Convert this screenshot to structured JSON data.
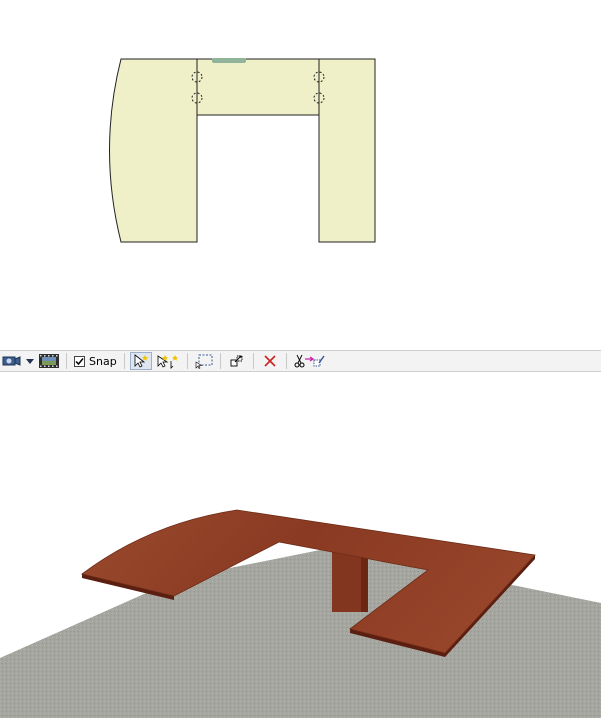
{
  "toolbar": {
    "snap_label": "Snap",
    "snap_checked": true,
    "icons": [
      "camera-icon",
      "dropdown-arrow-icon",
      "film-strip-icon",
      "checkbox-checked-icon",
      "select-icon",
      "multi-select-icon",
      "marquee-select-icon",
      "move-icon",
      "delete-icon",
      "cut-paste-icon"
    ]
  },
  "colors": {
    "plan_fill": "#eff0c8",
    "plan_stroke": "#222222",
    "handle": "#8fb49a",
    "wood": "#8c3a22",
    "floor": "#a6a6a0",
    "toolbar_bg": "#f3f3f3",
    "delete_red": "#cc2222"
  }
}
